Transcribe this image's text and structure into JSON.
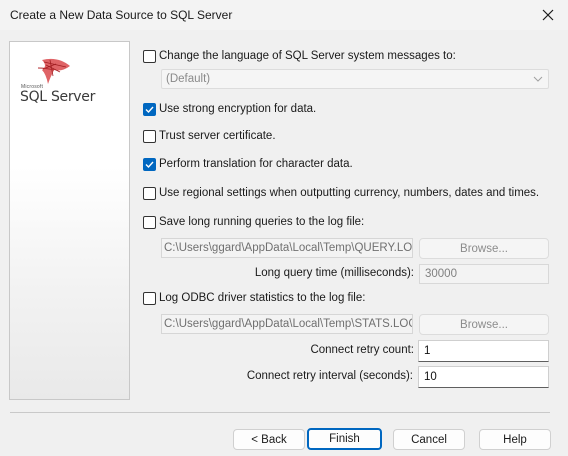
{
  "window": {
    "title": "Create a New Data Source to SQL Server",
    "close_glyph": "✕"
  },
  "brand": {
    "company": "Microsoft",
    "product": "SQL Server",
    "logo_icon": "sql-server-logo-icon"
  },
  "options": {
    "change_language": {
      "label": "Change the language of SQL Server system messages to:",
      "checked": false
    },
    "language_select": {
      "value": "(Default)"
    },
    "strong_encryption": {
      "label": "Use strong encryption for data.",
      "checked": true
    },
    "trust_certificate": {
      "label": "Trust server certificate.",
      "checked": false
    },
    "char_translation": {
      "label": "Perform translation for character data.",
      "checked": true
    },
    "regional_settings": {
      "label": "Use regional settings when outputting currency, numbers, dates and times.",
      "checked": false
    },
    "long_queries": {
      "label": "Save long running queries to the log file:",
      "checked": false
    },
    "long_queries_path": "C:\\Users\\ggard\\AppData\\Local\\Temp\\QUERY.LOG",
    "long_queries_browse": "Browse...",
    "long_query_time_label": "Long query time (milliseconds):",
    "long_query_time_value": "30000",
    "log_stats": {
      "label": "Log ODBC driver statistics to the log file:",
      "checked": false
    },
    "log_stats_path": "C:\\Users\\ggard\\AppData\\Local\\Temp\\STATS.LOG",
    "log_stats_browse": "Browse...",
    "retry_count_label": "Connect retry count:",
    "retry_count_value": "1",
    "retry_interval_label": "Connect retry interval (seconds):",
    "retry_interval_value": "10"
  },
  "footer": {
    "back": "< Back",
    "finish": "Finish",
    "cancel": "Cancel",
    "help": "Help"
  },
  "colors": {
    "accent": "#0067c0",
    "background": "#f0f0f0"
  }
}
